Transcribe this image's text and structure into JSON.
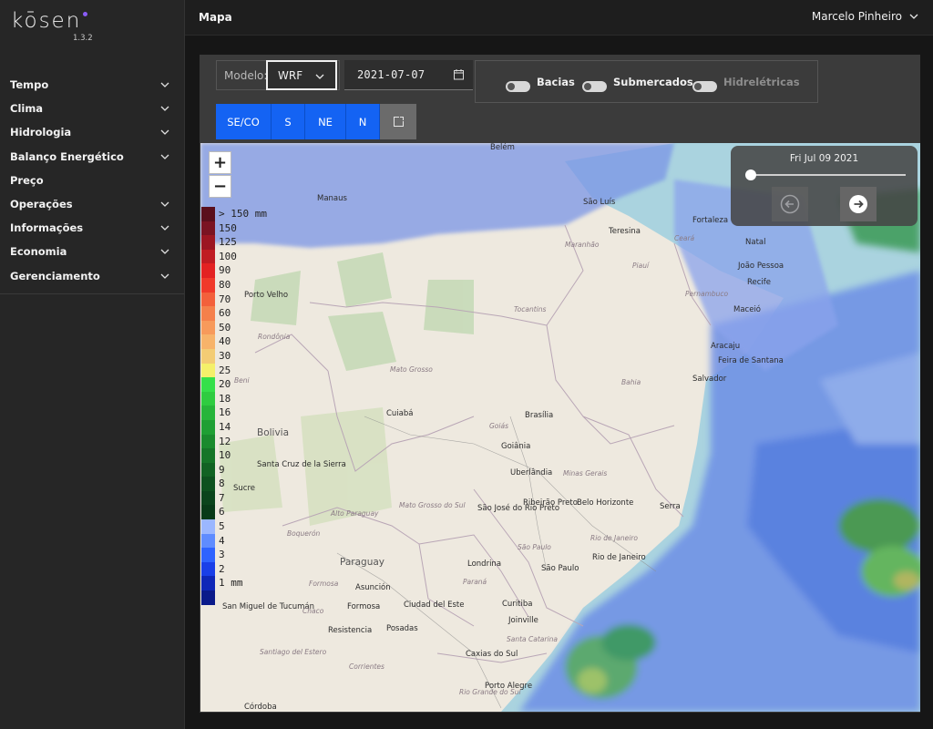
{
  "app": {
    "name": "kōsen",
    "version": "1.3.2"
  },
  "sidebar": {
    "items": [
      {
        "label": "Tempo",
        "has_children": true
      },
      {
        "label": "Clima",
        "has_children": true
      },
      {
        "label": "Hidrologia",
        "has_children": true
      },
      {
        "label": "Balanço Energético",
        "has_children": true
      },
      {
        "label": "Preço",
        "has_children": false
      },
      {
        "label": "Operações",
        "has_children": true
      },
      {
        "label": "Informações",
        "has_children": true
      },
      {
        "label": "Economia",
        "has_children": true
      },
      {
        "label": "Gerenciamento",
        "has_children": true
      }
    ]
  },
  "header": {
    "title": "Mapa",
    "user": "Marcelo Pinheiro"
  },
  "controls": {
    "model_label": "Modelo:",
    "model_value": "WRF",
    "date_value": "2021-07-07",
    "toggles": [
      {
        "label": "Bacias",
        "on": false,
        "enabled": true
      },
      {
        "label": "Submercados",
        "on": false,
        "enabled": true
      },
      {
        "label": "Hidrelétricas",
        "on": false,
        "enabled": false
      }
    ],
    "regions": [
      "SE/CO",
      "S",
      "NE",
      "N"
    ]
  },
  "map": {
    "zoom_in": "+",
    "zoom_out": "−",
    "timeline_date": "Fri Jul 09 2021",
    "legend": [
      {
        "label": "> 150 mm",
        "color": "#5a0f1c"
      },
      {
        "label": "150",
        "color": "#7a1322"
      },
      {
        "label": "125",
        "color": "#9c1622"
      },
      {
        "label": "100",
        "color": "#c01c22"
      },
      {
        "label": "90",
        "color": "#e32222"
      },
      {
        "label": "80",
        "color": "#f03a2a"
      },
      {
        "label": "70",
        "color": "#f3603b"
      },
      {
        "label": "60",
        "color": "#f5804b"
      },
      {
        "label": "50",
        "color": "#f79a5b"
      },
      {
        "label": "40",
        "color": "#f7b36a"
      },
      {
        "label": "30",
        "color": "#f3cc74"
      },
      {
        "label": "25",
        "color": "#f4f06a"
      },
      {
        "label": "20",
        "color": "#35e04a"
      },
      {
        "label": "18",
        "color": "#2fcc40"
      },
      {
        "label": "16",
        "color": "#27b53a"
      },
      {
        "label": "14",
        "color": "#1f9f33"
      },
      {
        "label": "12",
        "color": "#1a8a2d"
      },
      {
        "label": "10",
        "color": "#167528"
      },
      {
        "label": "9",
        "color": "#126223"
      },
      {
        "label": "8",
        "color": "#0e511f"
      },
      {
        "label": "7",
        "color": "#0b441c"
      },
      {
        "label": "6",
        "color": "#083a18"
      },
      {
        "label": "5",
        "color": "#9bb7ff"
      },
      {
        "label": "4",
        "color": "#5f8cff"
      },
      {
        "label": "3",
        "color": "#2e63ff"
      },
      {
        "label": "2",
        "color": "#1a3fe8"
      },
      {
        "label": "1 mm",
        "color": "#0f27b8"
      },
      {
        "label": "",
        "color": "#0a1a8a"
      }
    ],
    "labels": [
      {
        "text": "Belém",
        "cls": "city"
      },
      {
        "text": "Manaus",
        "cls": "city"
      },
      {
        "text": "São Luís",
        "cls": "city"
      },
      {
        "text": "Teresina",
        "cls": "city"
      },
      {
        "text": "Fortaleza",
        "cls": "city"
      },
      {
        "text": "Natal",
        "cls": "city"
      },
      {
        "text": "João Pessoa",
        "cls": "city"
      },
      {
        "text": "Recife",
        "cls": "city"
      },
      {
        "text": "Maceió",
        "cls": "city"
      },
      {
        "text": "Aracaju",
        "cls": "city"
      },
      {
        "text": "Feira de Santana",
        "cls": "city"
      },
      {
        "text": "Salvador",
        "cls": "city"
      },
      {
        "text": "Porto Velho",
        "cls": "city"
      },
      {
        "text": "Cuiabá",
        "cls": "city"
      },
      {
        "text": "Brasília",
        "cls": "city"
      },
      {
        "text": "Goiânia",
        "cls": "city"
      },
      {
        "text": "Uberlândia",
        "cls": "city"
      },
      {
        "text": "Belo Horizonte",
        "cls": "city"
      },
      {
        "text": "Serra",
        "cls": "city"
      },
      {
        "text": "Ribeirão Preto",
        "cls": "city"
      },
      {
        "text": "São José do Rio Preto",
        "cls": "city"
      },
      {
        "text": "Rio de Janeiro",
        "cls": "city"
      },
      {
        "text": "São Paulo",
        "cls": "city"
      },
      {
        "text": "Londrina",
        "cls": "city"
      },
      {
        "text": "Curitiba",
        "cls": "city"
      },
      {
        "text": "Joinville",
        "cls": "city"
      },
      {
        "text": "Caxias do Sul",
        "cls": "city"
      },
      {
        "text": "Porto Alegre",
        "cls": "city"
      },
      {
        "text": "Santa Cruz de la Sierra",
        "cls": "city"
      },
      {
        "text": "Sucre",
        "cls": "city"
      },
      {
        "text": "Asunción",
        "cls": "city"
      },
      {
        "text": "Formosa",
        "cls": "city"
      },
      {
        "text": "Ciudad del Este",
        "cls": "city"
      },
      {
        "text": "Posadas",
        "cls": "city"
      },
      {
        "text": "Resistencia",
        "cls": "city"
      },
      {
        "text": "San Miguel de Tucumán",
        "cls": "city"
      },
      {
        "text": "Córdoba",
        "cls": "city"
      },
      {
        "text": "Bolivia",
        "cls": "country"
      },
      {
        "text": "Paraguay",
        "cls": "country"
      },
      {
        "text": "Maranhão",
        "cls": "state"
      },
      {
        "text": "Piauí",
        "cls": "state"
      },
      {
        "text": "Ceará",
        "cls": "state"
      },
      {
        "text": "Pernambuco",
        "cls": "state"
      },
      {
        "text": "Tocantins",
        "cls": "state"
      },
      {
        "text": "Bahia",
        "cls": "state"
      },
      {
        "text": "Mato Grosso",
        "cls": "state"
      },
      {
        "text": "Rondônia",
        "cls": "state"
      },
      {
        "text": "Beni",
        "cls": "state"
      },
      {
        "text": "Goiás",
        "cls": "state"
      },
      {
        "text": "Minas Gerais",
        "cls": "state"
      },
      {
        "text": "Mato Grosso do Sul",
        "cls": "state"
      },
      {
        "text": "Alto Paraguay",
        "cls": "state"
      },
      {
        "text": "Boquerón",
        "cls": "state"
      },
      {
        "text": "Formosa",
        "cls": "state"
      },
      {
        "text": "Chaco",
        "cls": "state"
      },
      {
        "text": "Paraná",
        "cls": "state"
      },
      {
        "text": "Santa Catarina",
        "cls": "state"
      },
      {
        "text": "Rio Grande do Sul",
        "cls": "state"
      },
      {
        "text": "Corrientes",
        "cls": "state"
      },
      {
        "text": "Santiago del Estero",
        "cls": "state"
      },
      {
        "text": "Rio de Janeiro",
        "cls": "state"
      },
      {
        "text": "São Paulo",
        "cls": "state"
      }
    ]
  }
}
